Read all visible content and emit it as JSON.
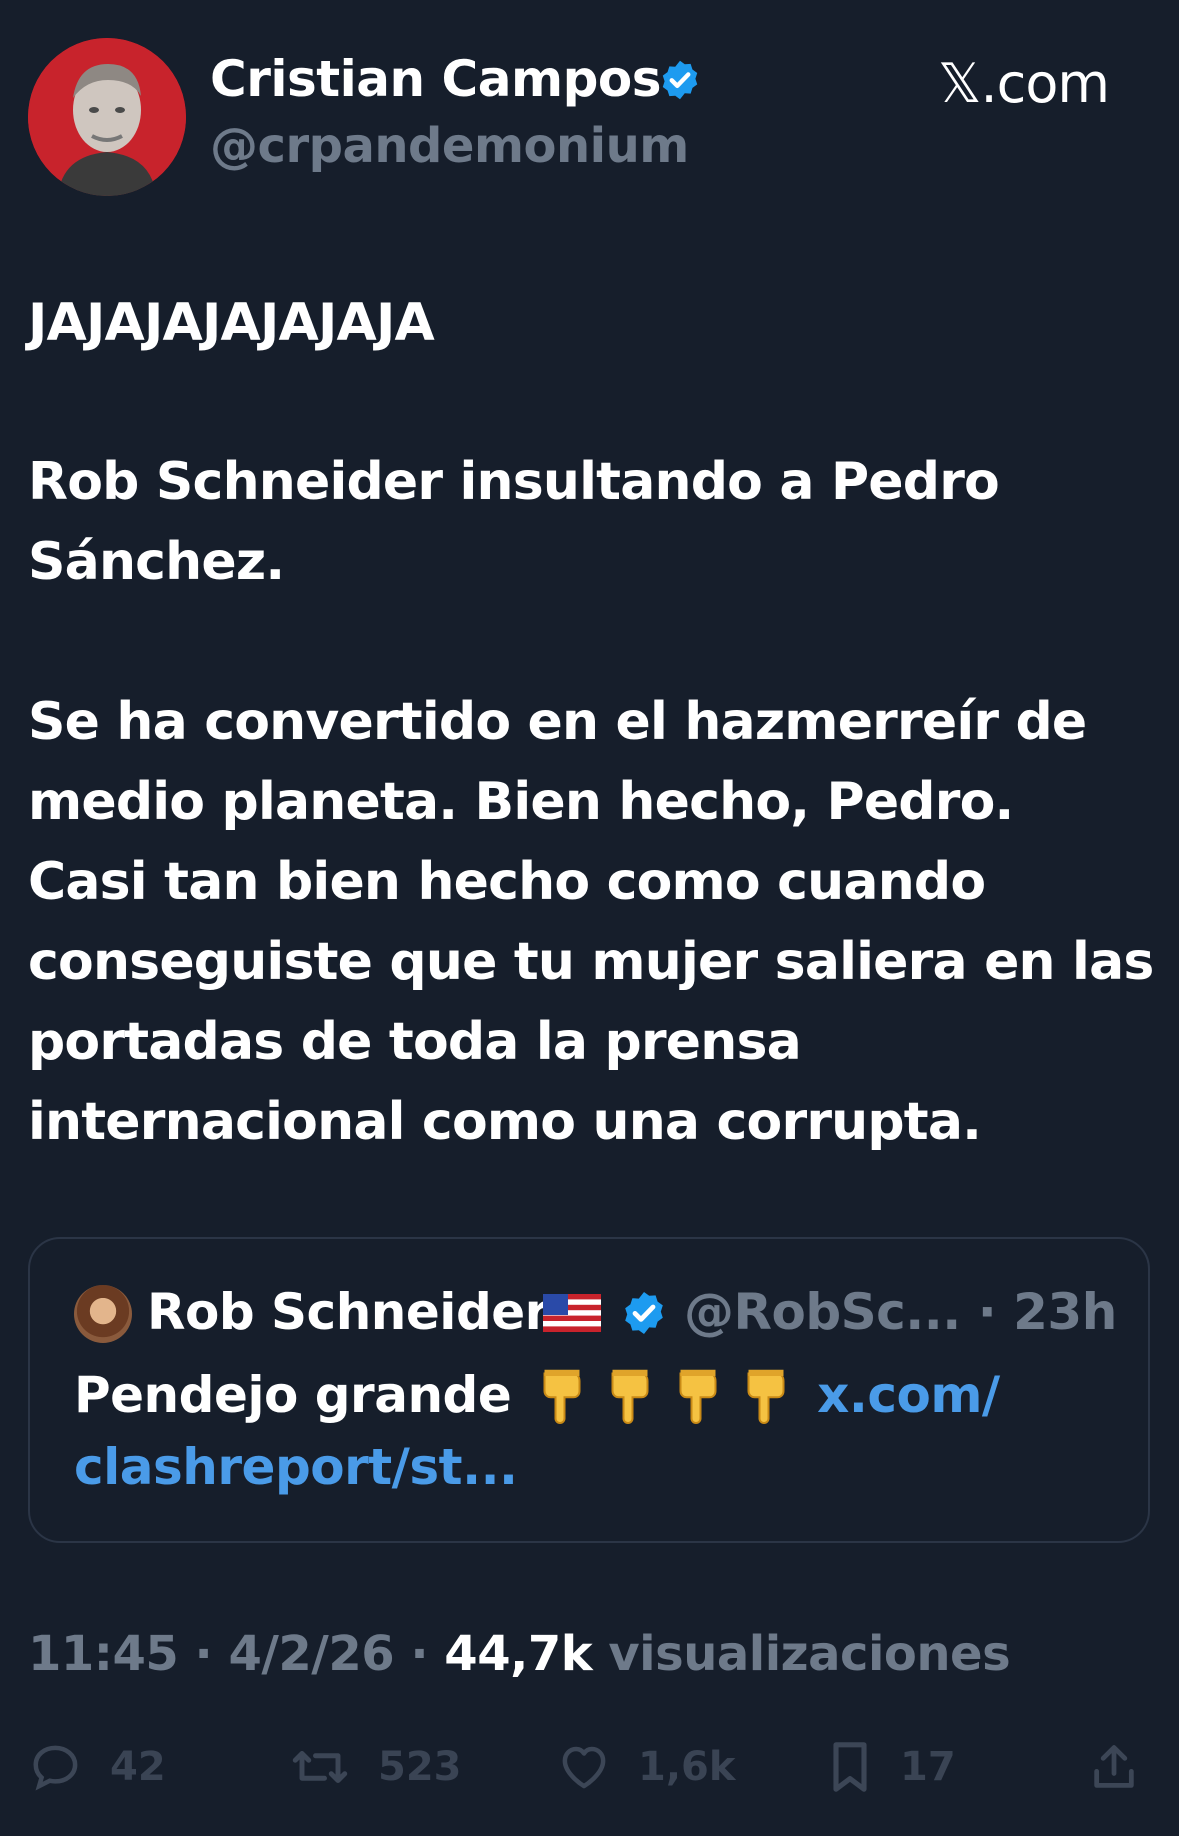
{
  "author": {
    "display_name": "Cristian Campos",
    "handle": "@crpandemonium",
    "verified": true,
    "avatar_icon": "avatar-photo"
  },
  "brand": "𝕏.com",
  "tweet": {
    "lines": [
      "JAJAJAJAJAJAJA",
      "Rob Schneider insultando a Pedro",
      "Sánchez.",
      "Se ha convertido en el hazmerreír de",
      "medio planeta. Bien hecho, Pedro.",
      "Casi tan bien hecho como cuando",
      "conseguiste que tu mujer saliera en las",
      "portadas de toda la prensa",
      "internacional como una corrupta."
    ]
  },
  "quote": {
    "display_name": "Rob Schneider",
    "flag": "🇺🇸",
    "verified": true,
    "handle": "@RobSc...",
    "separator": "·",
    "time": "23h",
    "text": "Pendejo grande",
    "emoji_icon": "pointing-down-icon",
    "emoji_count": 4,
    "link_part1": "x.com/",
    "link_part2": "clashreport/st..."
  },
  "meta": {
    "time": "11:45",
    "date": "4/2/26",
    "separator": "·",
    "views_count": "44,7k",
    "views_label": "visualizaciones"
  },
  "actions": {
    "replies": "42",
    "reposts": "523",
    "likes": "1,6k",
    "bookmarks": "17"
  },
  "colors": {
    "background": "#161e2b",
    "text": "#ffffff",
    "muted": "#6e7a8a",
    "link": "#4a9be8",
    "verified": "#1d9bf0",
    "avatar_bg": "#c8232c"
  }
}
